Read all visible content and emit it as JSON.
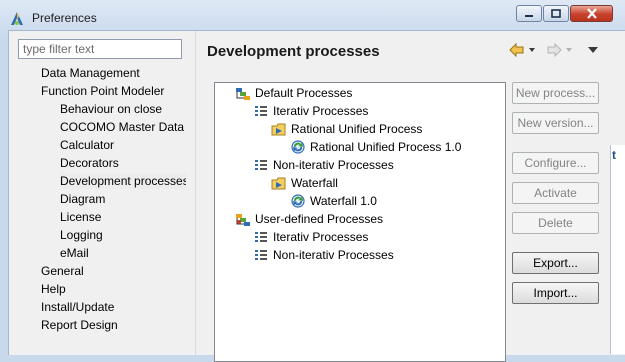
{
  "window": {
    "title": "Preferences"
  },
  "filter": {
    "placeholder": "type filter text"
  },
  "nav": {
    "items": [
      {
        "label": "Data Management",
        "level": 1
      },
      {
        "label": "Function Point Modeler",
        "level": 1
      },
      {
        "label": "Behaviour on close",
        "level": 2
      },
      {
        "label": "COCOMO Master Data",
        "level": 2
      },
      {
        "label": "Calculator",
        "level": 2
      },
      {
        "label": "Decorators",
        "level": 2
      },
      {
        "label": "Development processes",
        "level": 2,
        "selected": true
      },
      {
        "label": "Diagram",
        "level": 2
      },
      {
        "label": "License",
        "level": 2
      },
      {
        "label": "Logging",
        "level": 2
      },
      {
        "label": "eMail",
        "level": 2
      },
      {
        "label": "General",
        "level": 1
      },
      {
        "label": "Help",
        "level": 1
      },
      {
        "label": "Install/Update",
        "level": 1
      },
      {
        "label": "Report Design",
        "level": 1
      }
    ]
  },
  "page": {
    "title": "Development processes"
  },
  "tree": {
    "nodes": [
      {
        "label": "Default Processes",
        "depth": 0,
        "icon": "process-group-icon"
      },
      {
        "label": "Iterativ Processes",
        "depth": 1,
        "icon": "list-icon"
      },
      {
        "label": "Rational Unified Process",
        "depth": 2,
        "icon": "process-folder-icon"
      },
      {
        "label": "Rational Unified Process 1.0",
        "depth": 3,
        "icon": "process-version-icon"
      },
      {
        "label": "Non-iterativ Processes",
        "depth": 1,
        "icon": "list-icon"
      },
      {
        "label": "Waterfall",
        "depth": 2,
        "icon": "process-folder-icon"
      },
      {
        "label": "Waterfall 1.0",
        "depth": 3,
        "icon": "process-version-icon"
      },
      {
        "label": "User-defined Processes",
        "depth": 0,
        "icon": "user-process-group-icon"
      },
      {
        "label": "Iterativ Processes",
        "depth": 1,
        "icon": "list-icon"
      },
      {
        "label": "Non-iterativ Processes",
        "depth": 1,
        "icon": "list-icon"
      }
    ]
  },
  "buttons": {
    "new_process": "New process...",
    "new_version": "New version...",
    "configure": "Configure...",
    "activate": "Activate",
    "delete": "Delete",
    "export": "Export...",
    "import": "Import..."
  },
  "edge": {
    "char": "t"
  },
  "colors": {
    "selection": "#ececec",
    "close_button": "#c8412b",
    "back_arrow": "#e8a317",
    "heading": "#1a1a1a"
  }
}
